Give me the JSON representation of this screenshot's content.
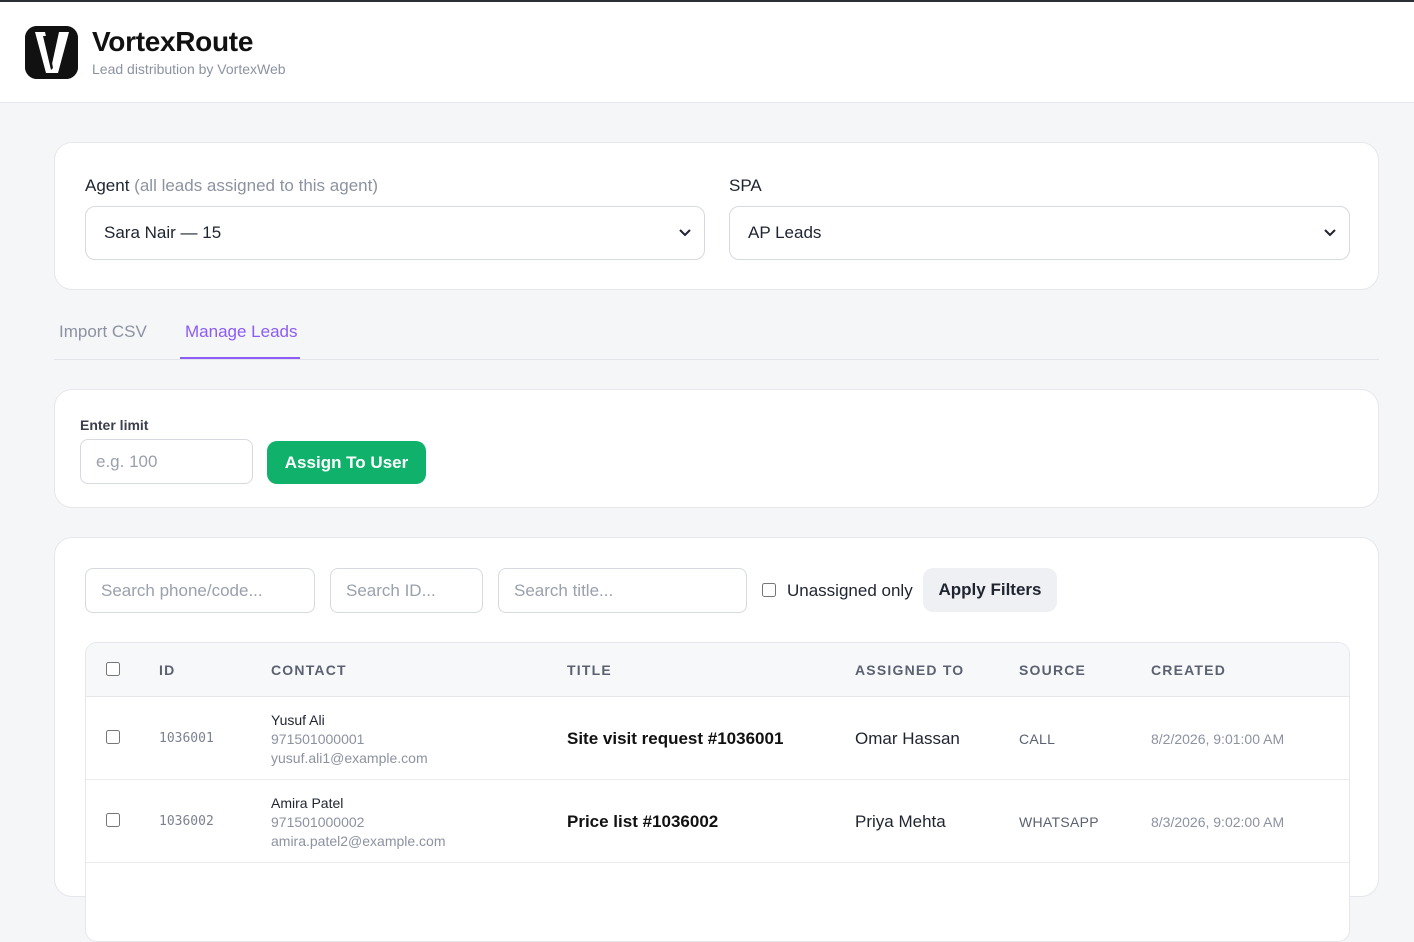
{
  "app": {
    "name": "VortexRoute",
    "tagline": "Lead distribution by VortexWeb",
    "logo_letter": "V"
  },
  "filters_top": {
    "agent_label": "Agent",
    "agent_hint": "(all leads assigned to this agent)",
    "agent_value": "Sara Nair — 15",
    "spa_label": "SPA",
    "spa_value": "AP Leads"
  },
  "tabs": [
    {
      "label": "Import CSV",
      "active": false
    },
    {
      "label": "Manage Leads",
      "active": true
    }
  ],
  "assign": {
    "limit_label": "Enter limit",
    "limit_placeholder": "e.g. 100",
    "assign_button": "Assign To User"
  },
  "search": {
    "phone_placeholder": "Search phone/code...",
    "id_placeholder": "Search ID...",
    "title_placeholder": "Search title...",
    "unassigned_label": "Unassigned only",
    "apply_button": "Apply Filters"
  },
  "table": {
    "columns": [
      "ID",
      "CONTACT",
      "TITLE",
      "ASSIGNED TO",
      "SOURCE",
      "CREATED"
    ],
    "rows": [
      {
        "id": "1036001",
        "contact_name": "Yusuf Ali",
        "contact_phone": "971501000001",
        "contact_email": "yusuf.ali1@example.com",
        "title": "Site visit request #1036001",
        "assigned_to": "Omar Hassan",
        "source": "CALL",
        "created": "8/2/2026, 9:01:00 AM"
      },
      {
        "id": "1036002",
        "contact_name": "Amira Patel",
        "contact_phone": "971501000002",
        "contact_email": "amira.patel2@example.com",
        "title": "Price list #1036002",
        "assigned_to": "Priya Mehta",
        "source": "WHATSAPP",
        "created": "8/3/2026, 9:02:00 AM"
      }
    ]
  },
  "colors": {
    "accent": "#8b5cf6",
    "primary_button": "#10b26b",
    "background": "#f5f6f8"
  }
}
